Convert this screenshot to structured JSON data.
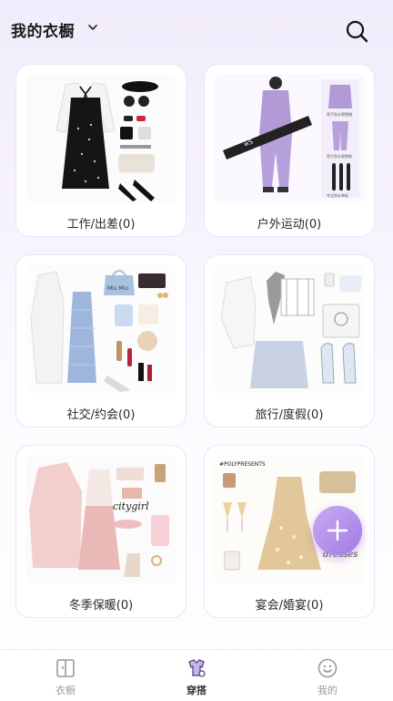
{
  "header": {
    "title": "我的衣橱"
  },
  "cards": [
    {
      "label": "工作/出差(0)"
    },
    {
      "label": "户外运动(0)"
    },
    {
      "label": "社交/约会(0)"
    },
    {
      "label": "旅行/度假(0)"
    },
    {
      "label": "冬季保暖(0)"
    },
    {
      "label": "宴会/婚宴(0)"
    }
  ],
  "collage_text": {
    "outdoor_1": "男子防水滑雪服",
    "outdoor_2": "男子防水滑雪裤",
    "outdoor_3": "专业防水单板",
    "social_1": "Miu Miu",
    "winter_1": "citygirl",
    "party_1": "#POLYPRESENTS",
    "party_2": "dresses"
  },
  "tabs": [
    {
      "label": "衣橱",
      "icon": "wardrobe-icon"
    },
    {
      "label": "穿搭",
      "icon": "outfit-icon"
    },
    {
      "label": "我的",
      "icon": "smiley-icon"
    }
  ],
  "colors": {
    "accent": "#a27ae4",
    "active_tab": "#333333",
    "inactive_tab": "#9a9a9a"
  }
}
